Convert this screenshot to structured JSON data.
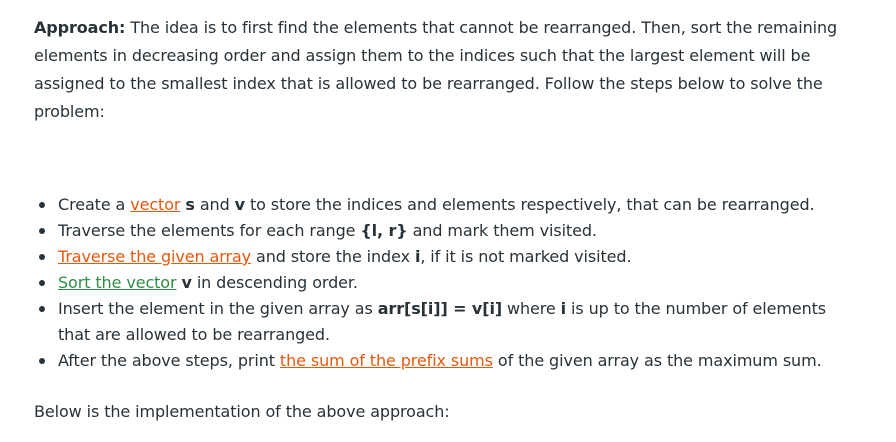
{
  "approach": {
    "label": "Approach:",
    "text": " The idea is to first find the elements that cannot be rearranged. Then, sort the remaining elements in decreasing order and assign them to the indices such that the largest element will be assigned to the smallest index that is allowed to be rearranged. Follow the steps below to solve the problem:"
  },
  "steps": [
    {
      "t1": "Create a ",
      "link": "vector",
      "t2": " ",
      "b1": "s",
      "t3": " and ",
      "b2": "v",
      "t4": " to store the indices and elements respectively, that can be rearranged."
    },
    {
      "t1": "Traverse the elements for each range ",
      "b1": "{l, r}",
      "t2": " and mark them visited."
    },
    {
      "link": "Traverse the given array",
      "t1": " and store the index ",
      "b1": "i",
      "t2": ", if it is not marked visited."
    },
    {
      "link": "Sort the vector",
      "t1": " ",
      "b1": "v",
      "t2": " in descending order."
    },
    {
      "t1": "Insert the element in the given array as ",
      "b1": "arr[s[i]] = v[i]",
      "t2": " where ",
      "b2": "i",
      "t3": " is up to the number of elements that are allowed to be rearranged."
    },
    {
      "t1": "After the above steps, print ",
      "link": "the sum of the prefix sums",
      "t2": " of the given array as the maximum sum."
    }
  ],
  "footer": "Below is the implementation of the above approach:",
  "colors": {
    "text": "#273239",
    "link_orange": "#e8580c",
    "link_green": "#2f8d46"
  }
}
